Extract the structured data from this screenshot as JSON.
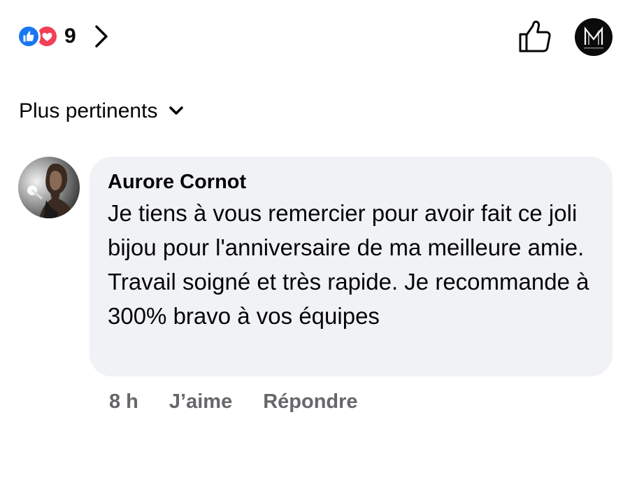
{
  "header": {
    "reaction_count": "9",
    "reaction_icons": [
      "like-icon",
      "love-icon"
    ],
    "like_color": "#1877f2",
    "love_color": "#f33e58",
    "page_avatar_icon": "brand-logo-m"
  },
  "sort": {
    "label": "Plus pertinents",
    "icon": "chevron-down-icon"
  },
  "comment": {
    "author": "Aurore Cornot",
    "text": "Je tiens à vous remercier pour avoir fait ce joli bijou pour l'anniversaire de ma meilleure amie. Travail soigné et très rapide. Je recommande à 300% bravo à vos équipes",
    "time": "8 h",
    "like_label": "J’aime",
    "reply_label": "Répondre",
    "bubble_color": "#f0f2f5",
    "meta_color": "#65676b"
  }
}
